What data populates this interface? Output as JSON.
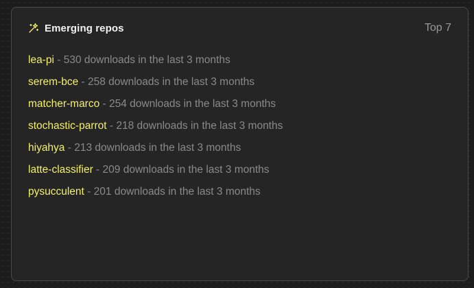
{
  "widget": {
    "title": "Emerging repos",
    "icon": "sparkle-wand-icon",
    "badge": "Top 7",
    "separator": " - ",
    "accent_color": "#f4f06b",
    "muted_color": "#8a8a8a"
  },
  "repos": [
    {
      "name": "lea-pi",
      "count": "530",
      "suffix": " downloads in the last 3 months"
    },
    {
      "name": "serem-bce",
      "count": "258",
      "suffix": " downloads in the last 3 months"
    },
    {
      "name": "matcher-marco",
      "count": "254",
      "suffix": " downloads in the last 3 months"
    },
    {
      "name": "stochastic-parrot",
      "count": "218",
      "suffix": " downloads in the last 3 months"
    },
    {
      "name": "hiyahya",
      "count": "213",
      "suffix": " downloads in the last 3 months"
    },
    {
      "name": "latte-classifier",
      "count": "209",
      "suffix": " downloads in the last 3 months"
    },
    {
      "name": "pysucculent",
      "count": "201",
      "suffix": " downloads in the last 3 months"
    }
  ]
}
